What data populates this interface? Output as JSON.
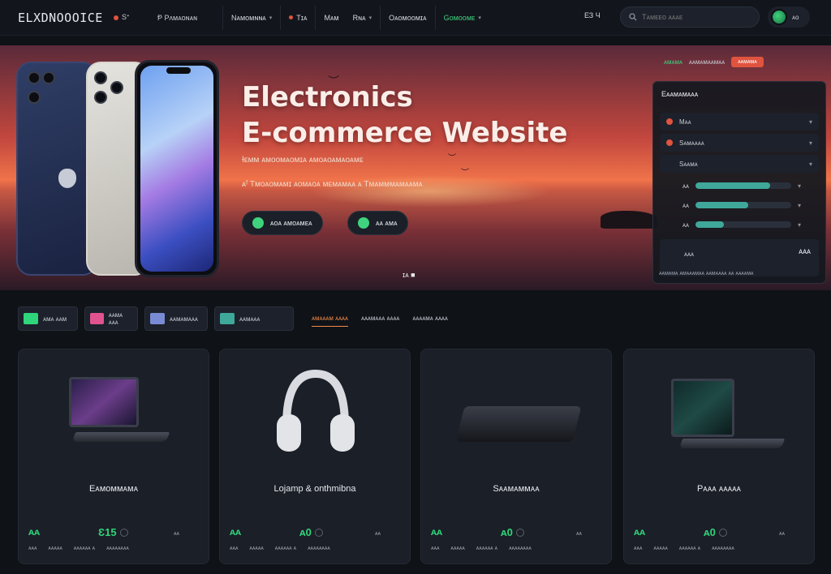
{
  "nav": {
    "brand": "ELXDNOOOICE",
    "mini": "Sᐩ",
    "mini2": "Ᵽ Pᴧᴍᴀᴏɴᴀɴ",
    "links": [
      {
        "label": "Nᴀᴍᴏᴍɴɴᴀ",
        "caret": true
      },
      {
        "label": "Tɪᴀ",
        "caret": false
      },
      {
        "label": "Mᴀᴍ",
        "caret": false
      },
      {
        "label": "Rɴᴀ",
        "caret": true
      },
      {
        "label": "Oᴀᴏᴍᴏᴏᴍɪᴀ",
        "caret": false
      },
      {
        "label": "Gᴏᴍᴏᴏᴍᴇ",
        "caret": true
      }
    ],
    "cart": "ЕЗ Ч",
    "search_placeholder": "Tᴀᴍᴇᴇᴏ ᴀᴀᴀᴇ",
    "user_label": "ᴀᴏ"
  },
  "hero": {
    "title_line1": "Electronics",
    "title_line2": "E-commerce Website",
    "subtitle1": "Ɨᴇᴍᴍ ᴀᴍᴏᴏᴍᴀᴏᴍɪᴀ ᴀᴍᴏᴀᴏᴀᴍᴀᴏᴀᴍᴇ",
    "subtitle2": "ᴀᶠ Tᴍᴏᴀᴏᴍᴀᴍɪ ᴀᴏᴍᴀᴏᴀ ᴍᴇᴍᴀᴍᴀᴀ ᴀ Tᴍᴀᴍᴍᴍᴀᴍᴀᴀᴍᴀ",
    "btn1": "ᴀᴏᴀ ᴀᴍᴏᴀᴍᴇᴀ",
    "btn2": "ᴀᴀ ᴀᴍᴀ",
    "pager": "ɪᴀ ■"
  },
  "panel": {
    "top_label": "ᴀᴍᴀᴍᴀ",
    "top_label2": "ᴀᴀᴍᴀᴍᴀᴀᴍᴀᴀ",
    "badge": "ᴀᴀᴍᴀᴍᴀ",
    "title": "Eᴀᴀᴍᴀᴍᴀᴀᴀ",
    "rows": [
      "Mᴀᴀ",
      "Sᴀᴍᴀᴀᴀᴀ",
      "Sᴀᴀᴍᴀ"
    ],
    "bars": [
      {
        "label": "ᴀᴀ",
        "value": 0.78
      },
      {
        "label": "ᴀᴀ",
        "value": 0.55
      },
      {
        "label": "ᴀᴀ",
        "value": 0.3
      }
    ],
    "graph_label": "ᴀᴀᴀ",
    "graph_value": "ᴀᴀᴀ",
    "footer": "ᴀᴀᴍᴀᴍᴀ ᴀᴍᴀᴀᴀᴍᴀᴀ ᴀᴀᴍᴀᴀᴀᴀ ᴀᴀ ᴀᴀᴀᴀᴍᴀ"
  },
  "chips": [
    {
      "label": "ᴀᴍᴀ ᴀᴀᴍ",
      "swatch": "#2fd57a"
    },
    {
      "label": "ᴀᴀᴍᴀ ᴀᴀᴀ",
      "swatch": "#e0538f"
    },
    {
      "label": "ᴀᴀᴍᴀᴍᴀᴀᴀ",
      "swatch": "#7a8bd6"
    },
    {
      "label": "ᴀᴀᴍᴀᴀᴀ",
      "swatch": "#3fa89a"
    }
  ],
  "tabs": [
    "ᴀᴍᴀᴀᴀᴍ ᴀᴀᴀᴀ",
    "ᴀᴀᴀᴍᴀᴀᴀ ᴀᴀᴀᴀ",
    "ᴀᴀᴀᴀᴍᴀ ᴀᴀᴀᴀ"
  ],
  "products": [
    {
      "name": "Eᴀᴍᴏᴍᴍᴀᴍᴀ",
      "price_left": "ᴀᴀ",
      "price": "Ɛ15",
      "tag": "ᴀᴀ",
      "meta": [
        "ᴀᴀᴀ",
        "ᴀᴀᴀᴀᴀ",
        "ᴀᴀᴀᴀᴀᴀ ᴀ",
        "ᴀᴀᴀᴀᴀᴀᴀᴀ"
      ]
    },
    {
      "name": "Lojamp & onthmibna",
      "price_left": "ᴀᴀ",
      "price": "ᴀ0",
      "tag": "ᴀᴀ",
      "meta": [
        "ᴀᴀᴀ",
        "ᴀᴀᴀᴀᴀ",
        "ᴀᴀᴀᴀᴀᴀ ᴀ",
        "ᴀᴀᴀᴀᴀᴀᴀᴀ"
      ]
    },
    {
      "name": "Sᴀᴀᴍᴀᴍᴍᴀᴀ",
      "price_left": "ᴀᴀ",
      "price": "ᴀ0",
      "tag": "ᴀᴀ",
      "meta": [
        "ᴀᴀᴀ",
        "ᴀᴀᴀᴀᴀ",
        "ᴀᴀᴀᴀᴀᴀ ᴀ",
        "ᴀᴀᴀᴀᴀᴀᴀᴀ"
      ]
    },
    {
      "name": "Pᴀᴀᴀ ᴀᴀᴀᴀᴀ",
      "price_left": "ᴀᴀ",
      "price": "ᴀ0",
      "tag": "ᴀᴀ",
      "meta": [
        "ᴀᴀᴀ",
        "ᴀᴀᴀᴀᴀ",
        "ᴀᴀᴀᴀᴀᴀ ᴀ",
        "ᴀᴀᴀᴀᴀᴀᴀᴀ"
      ]
    }
  ],
  "colors": {
    "accent_green": "#2fd57a",
    "accent_orange": "#f08a4a",
    "accent_red": "#e0533f",
    "bg": "#0f1217"
  }
}
